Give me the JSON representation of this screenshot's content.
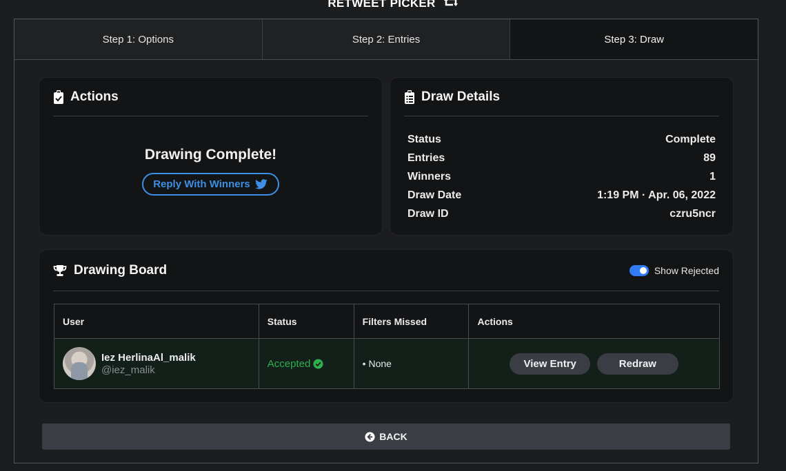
{
  "app": {
    "title": "RETWEET PICKER",
    "title_icon": "retweet-icon"
  },
  "tabs": [
    {
      "label": "Step 1: Options",
      "active": false
    },
    {
      "label": "Step 2: Entries",
      "active": false
    },
    {
      "label": "Step 3: Draw",
      "active": true
    }
  ],
  "actions": {
    "title": "Actions",
    "icon": "clipboard-check-icon",
    "message": "Drawing Complete!",
    "reply_label": "Reply With Winners",
    "reply_icon": "twitter-bird-icon"
  },
  "details": {
    "title": "Draw Details",
    "icon": "clipboard-list-icon",
    "rows": [
      {
        "label": "Status",
        "value": "Complete"
      },
      {
        "label": "Entries",
        "value": "89"
      },
      {
        "label": "Winners",
        "value": "1"
      },
      {
        "label": "Draw Date",
        "value": "1:19 PM · Apr. 06, 2022"
      },
      {
        "label": "Draw ID",
        "value": "czru5ncr"
      }
    ]
  },
  "board": {
    "title": "Drawing Board",
    "icon": "trophy-icon",
    "toggle_label": "Show Rejected",
    "toggle_on": true,
    "columns": [
      "User",
      "Status",
      "Filters Missed",
      "Actions"
    ],
    "rows": [
      {
        "name": "Iez HerlinaAl_malik",
        "handle": "@iez_malik",
        "status": "Accepted",
        "filters_missed": "• None",
        "view_label": "View Entry",
        "redraw_label": "Redraw"
      }
    ]
  },
  "back": {
    "label": "BACK",
    "icon": "circle-arrow-left-icon"
  },
  "colors": {
    "accent_blue": "#3d8fe5",
    "accepted_green": "#2fae4e",
    "background": "#1c1d1f",
    "card": "#131415"
  }
}
